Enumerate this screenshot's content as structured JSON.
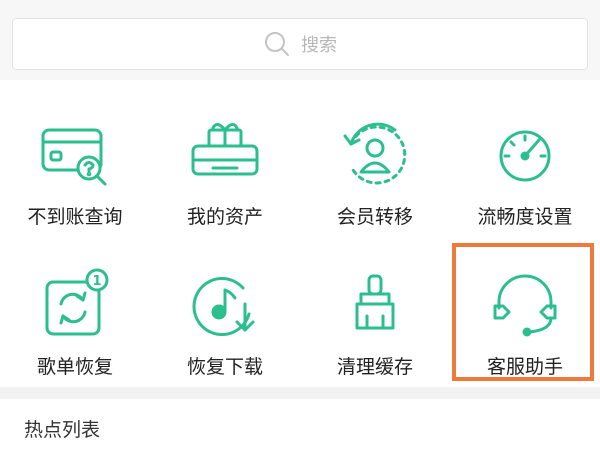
{
  "search": {
    "placeholder": "搜索",
    "icon": "search-icon"
  },
  "colors": {
    "accent": "#2bbf8e",
    "highlight": "#f07a3c"
  },
  "grid_items": [
    {
      "label": "不到账查询",
      "icon": "card-question-icon"
    },
    {
      "label": "我的资产",
      "icon": "gift-box-icon"
    },
    {
      "label": "会员转移",
      "icon": "user-transfer-icon"
    },
    {
      "label": "流畅度设置",
      "icon": "gauge-icon"
    },
    {
      "label": "歌单恢复",
      "icon": "playlist-restore-icon",
      "badge": "1"
    },
    {
      "label": "恢复下载",
      "icon": "music-download-icon"
    },
    {
      "label": "清理缓存",
      "icon": "brush-icon"
    },
    {
      "label": "客服助手",
      "icon": "headset-icon",
      "highlighted": true
    }
  ],
  "section": {
    "title": "热点列表"
  }
}
